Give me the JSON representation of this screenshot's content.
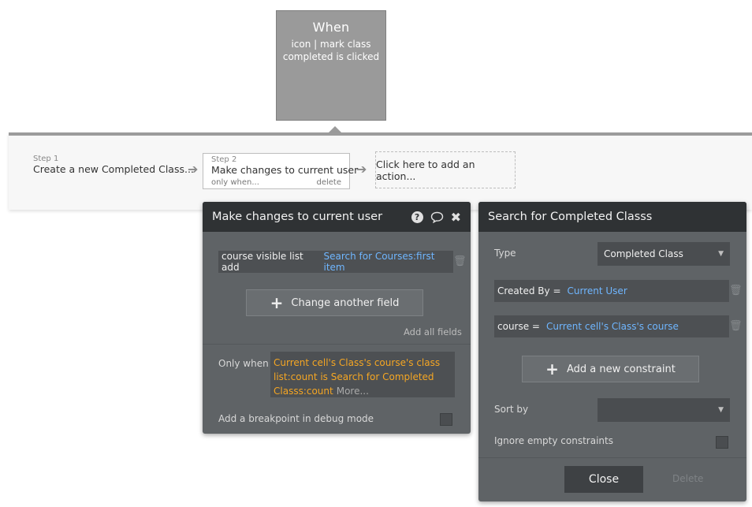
{
  "event": {
    "title": "When",
    "description": "icon | mark class completed is clicked"
  },
  "steps": [
    {
      "num": "Step 1",
      "title": "Create a new Completed Class..."
    },
    {
      "num": "Step 2",
      "title": "Make changes to current user",
      "only_when": "only when...",
      "delete": "delete"
    }
  ],
  "add_action": "Click here to add an action...",
  "action_panel": {
    "title": "Make changes to current user",
    "field": {
      "name": "course visible list add",
      "value": "Search for Courses:first item"
    },
    "change_field_btn": "Change another field",
    "add_all_fields": "Add all fields",
    "only_when_label": "Only when",
    "only_when_expr": "Current cell's Class's course's class list:count is Search for Completed Classs:count",
    "more": "More...",
    "breakpoint": "Add a breakpoint in debug mode"
  },
  "search_panel": {
    "title": "Search for Completed Classs",
    "type_label": "Type",
    "type_value": "Completed Class",
    "constraints": [
      {
        "field": "Created By =",
        "value": "Current User"
      },
      {
        "field": "course =",
        "value": "Current cell's Class's course"
      }
    ],
    "add_constraint_btn": "Add a new constraint",
    "sort_by_label": "Sort by",
    "sort_by_value": "",
    "ignore_empty": "Ignore empty constraints",
    "close_btn": "Close",
    "delete_btn": "Delete"
  },
  "colors": {
    "panel_bg": "#5f6366",
    "panel_header": "#2f3234",
    "link_blue": "#6fb6ff",
    "expr_orange": "#f5a623",
    "event_gray": "#9a9a9a"
  }
}
